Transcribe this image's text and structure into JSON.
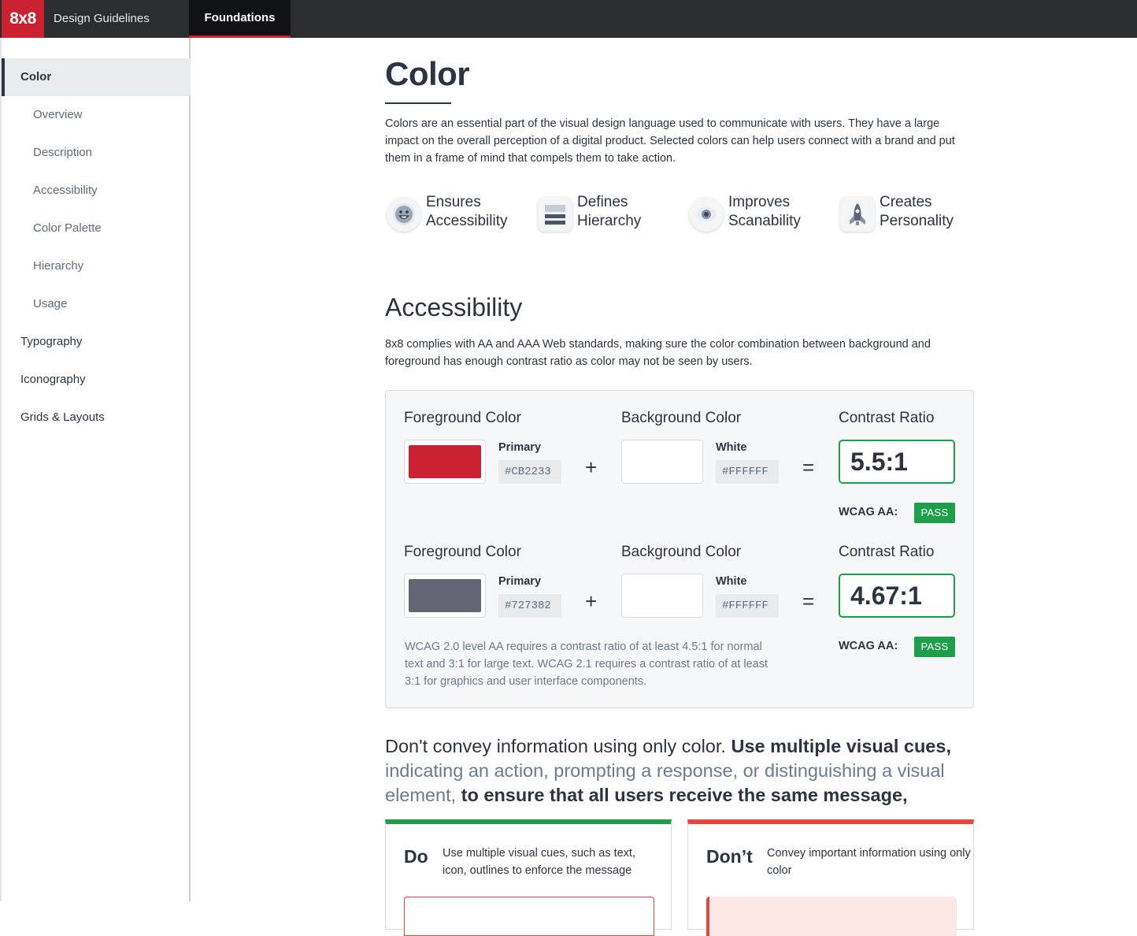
{
  "header": {
    "logo": "8x8",
    "app_title": "Design Guidelines",
    "tab": "Foundations"
  },
  "sidebar": {
    "items": [
      {
        "label": "Color",
        "active": true
      },
      {
        "label": "Overview",
        "sub": true
      },
      {
        "label": "Description",
        "sub": true
      },
      {
        "label": "Accessibility",
        "sub": true
      },
      {
        "label": "Color Palette",
        "sub": true
      },
      {
        "label": "Hierarchy",
        "sub": true
      },
      {
        "label": "Usage",
        "sub": true
      },
      {
        "label": "Typography"
      },
      {
        "label": "Iconography"
      },
      {
        "label": "Grids & Layouts"
      }
    ]
  },
  "main": {
    "title": "Color",
    "intro": "Colors are an essential part of the visual design language used to communicate with users. They have a large impact on the overall perception of a digital product. Selected colors can help users connect with a brand and put them in a frame of mind that compels them to take action.",
    "features": [
      {
        "line1": "Ensures",
        "line2": "Accessibility",
        "icon": "smiley-face-icon"
      },
      {
        "line1": "Defines",
        "line2": "Hierarchy",
        "icon": "stacked-layers-icon"
      },
      {
        "line1": "Improves",
        "line2": "Scanability",
        "icon": "eye-icon"
      },
      {
        "line1": "Creates",
        "line2": "Personality",
        "icon": "rocket-icon"
      }
    ],
    "accessibility": {
      "heading": "Accessibility",
      "desc": "8x8 complies with AA and AAA Web standards, making sure the color combination between background and foreground has enough contrast ratio as color may not be seen by users.",
      "fg_label": "Foreground Color",
      "bg_label": "Background Color",
      "ratio_label": "Contrast Ratio",
      "wcag_label": "WCAG AA:",
      "plus": "+",
      "equals": "=",
      "rows": [
        {
          "fg_name": "Primary",
          "fg_hex": "#CB2233",
          "fg_color": "#cb2233",
          "bg_name": "White",
          "bg_hex": "#FFFFFF",
          "bg_color": "#ffffff",
          "ratio": "5.5:1",
          "result": "PASS"
        },
        {
          "fg_name": "Primary",
          "fg_hex": "#727382",
          "fg_color": "#646574",
          "bg_name": "White",
          "bg_hex": "#FFFFFF",
          "bg_color": "#ffffff",
          "ratio": "4.67:1",
          "result": "PASS"
        }
      ],
      "note": "WCAG 2.0 level AA requires a contrast ratio of at least 4.5:1 for normal text and 3:1 for large text. WCAG 2.1 requires a contrast ratio of at least 3:1 for graphics and user interface components."
    },
    "statement": {
      "part1": "Don't convey information using only color. ",
      "part2": "Use multiple visual cues,",
      "part3": " indicating an action, prompting a response, or distinguishing a visual element,",
      "part4": " to ensure that all users receive the same message,"
    },
    "do": {
      "title": "Do",
      "text": "Use multiple visual cues, such as text, icon, outlines to enforce the message"
    },
    "dont": {
      "title": "Don’t",
      "text": "Convey important information using only color"
    }
  }
}
